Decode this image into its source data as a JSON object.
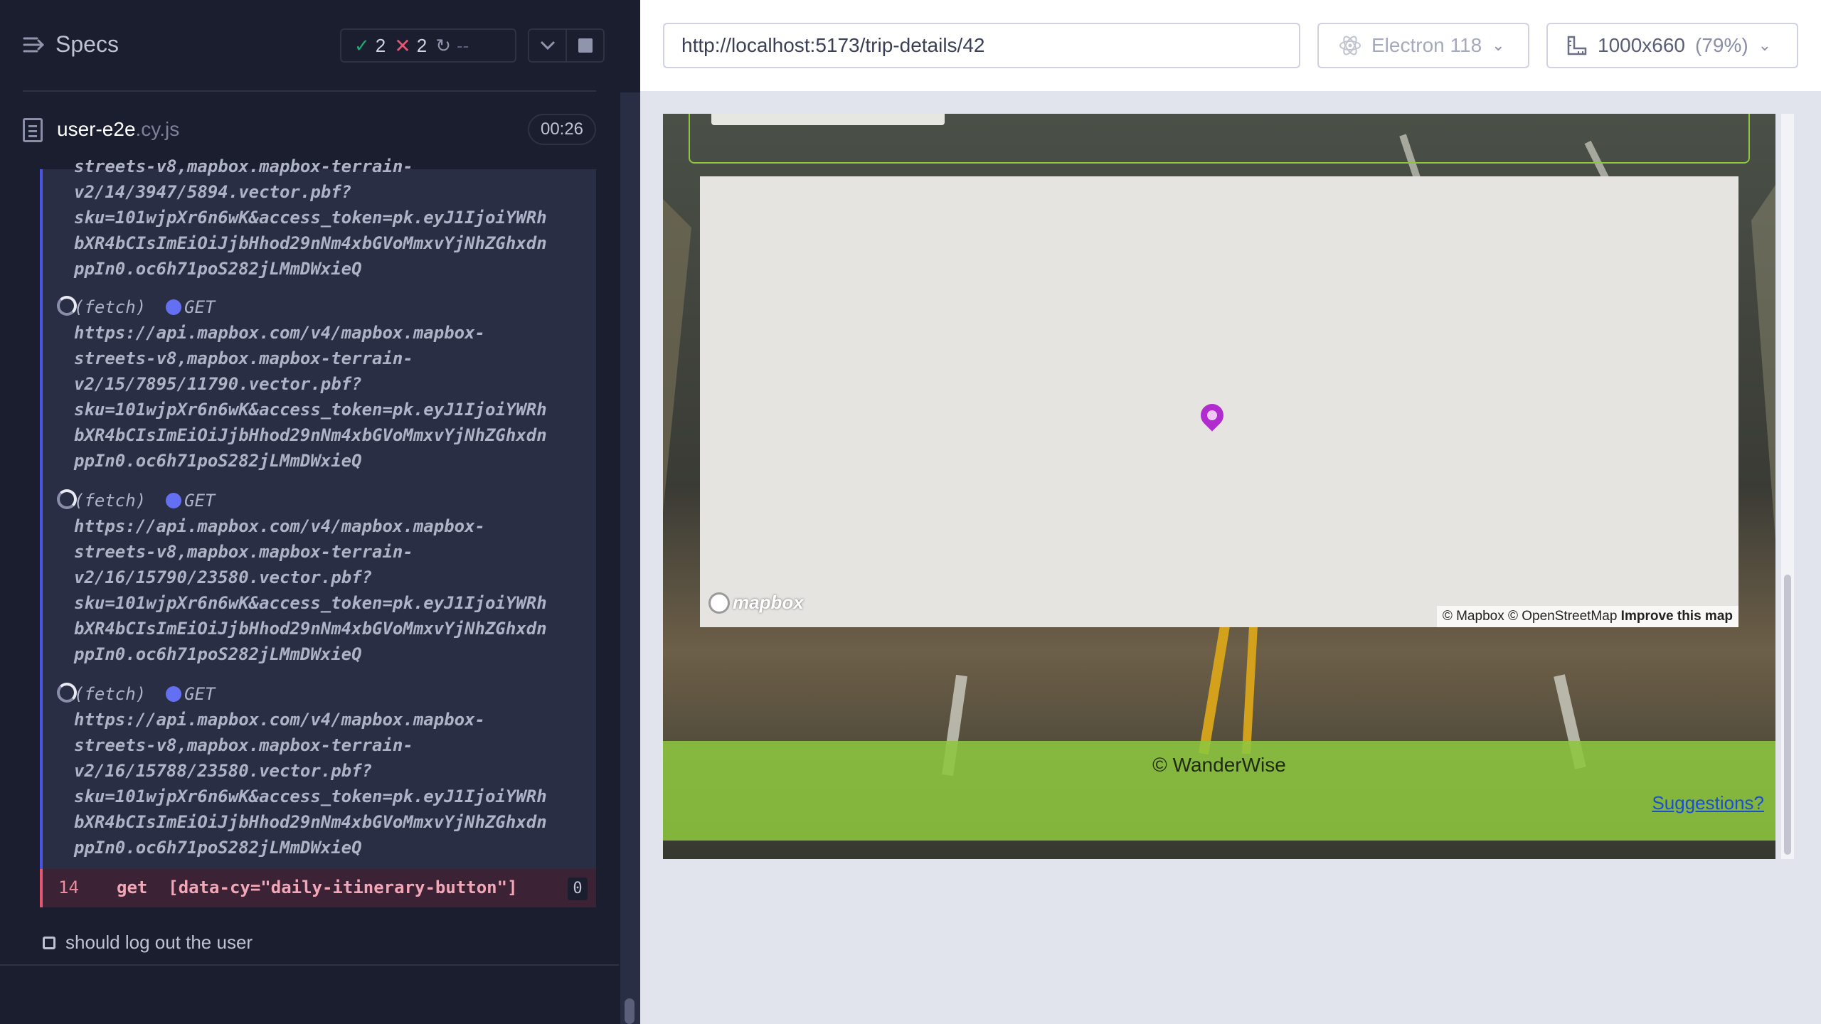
{
  "reporter": {
    "title": "Specs",
    "stats": {
      "passed": "2",
      "failed": "2",
      "pending": "--"
    },
    "spec": {
      "name": "user-e2e",
      "ext": ".cy.js",
      "duration": "00:26"
    },
    "log": {
      "top_lines": [
        "streets-v8,mapbox.mapbox-terrain-",
        "v2/14/3947/5894.vector.pbf?",
        "sku=101wjpXr6n6wK&access_token=pk.eyJ1IjoiYWRh",
        "bXR4bCIsImEiOiJjbHhod29nNm4xbGVoMmxvYjNhZGhxdn",
        "ppIn0.oc6h71poS282jLMmDWxieQ"
      ],
      "fetches": [
        {
          "label": "(fetch)",
          "method": "GET",
          "lines": [
            "https://api.mapbox.com/v4/mapbox.mapbox-",
            "streets-v8,mapbox.mapbox-terrain-",
            "v2/15/7895/11790.vector.pbf?",
            "sku=101wjpXr6n6wK&access_token=pk.eyJ1IjoiYWRh",
            "bXR4bCIsImEiOiJjbHhod29nNm4xbGVoMmxvYjNhZGhxdn",
            "ppIn0.oc6h71poS282jLMmDWxieQ"
          ]
        },
        {
          "label": "(fetch)",
          "method": "GET",
          "lines": [
            "https://api.mapbox.com/v4/mapbox.mapbox-",
            "streets-v8,mapbox.mapbox-terrain-",
            "v2/16/15790/23580.vector.pbf?",
            "sku=101wjpXr6n6wK&access_token=pk.eyJ1IjoiYWRh",
            "bXR4bCIsImEiOiJjbHhod29nNm4xbGVoMmxvYjNhZGhxdn",
            "ppIn0.oc6h71poS282jLMmDWxieQ"
          ]
        },
        {
          "label": "(fetch)",
          "method": "GET",
          "lines": [
            "https://api.mapbox.com/v4/mapbox.mapbox-",
            "streets-v8,mapbox.mapbox-terrain-",
            "v2/16/15788/23580.vector.pbf?",
            "sku=101wjpXr6n6wK&access_token=pk.eyJ1IjoiYWRh",
            "bXR4bCIsImEiOiJjbHhod29nNm4xbGVoMmxvYjNhZGhxdn",
            "ppIn0.oc6h71poS282jLMmDWxieQ"
          ]
        }
      ],
      "failed_command": {
        "number": "14",
        "text": "get  [data-cy=\"daily-itinerary-button\"]",
        "count": "0"
      }
    },
    "next_test": "should log out the user"
  },
  "aut": {
    "url": "http://localhost:5173/trip-details/42",
    "browser": "Electron 118",
    "viewport": "1000x660",
    "zoom": "(79%)",
    "page": {
      "map_logo": "mapbox",
      "attribution_prefix": "© Mapbox © OpenStreetMap",
      "attribution_link": "Improve this map",
      "footer_copyright": "© WanderWise",
      "footer_link": "Suggestions?"
    }
  },
  "colors": {
    "accent": "#4956e3",
    "pass": "#1fa971",
    "fail": "#e45770",
    "footer": "#8dc63f",
    "pin": "#b12ccf"
  }
}
